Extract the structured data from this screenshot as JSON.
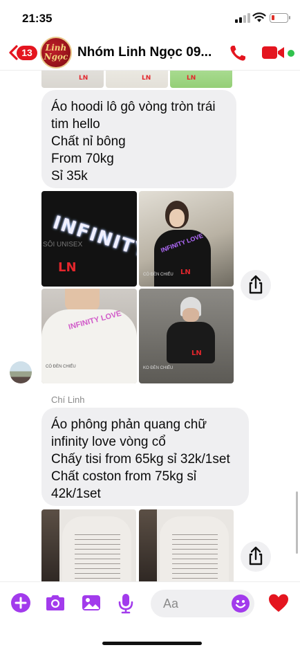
{
  "status": {
    "time": "21:35"
  },
  "header": {
    "back_badge": "13",
    "group_logo_line1": "Linh",
    "group_logo_line2": "Ngọc",
    "title": "Nhóm Linh Ngọc 09..."
  },
  "messages": {
    "msg1": [
      "Áo hoodi lô gô vòng tròn trái",
      "tim hello",
      "Chất nỉ bông",
      "From 70kg",
      "Sỉ 35k"
    ],
    "sender_name": "Chí Linh",
    "msg2": [
      "Áo phông phản quang chữ",
      "infinity love vòng cổ",
      "Chấy tisi from 65kg sỉ 32k/1set",
      "Chất coston from 75kg sỉ",
      "42k/1set"
    ]
  },
  "photos": {
    "p1_text": "INFINITY",
    "p1_tag": "SÔI UNISEX",
    "p1_brand": "LN",
    "p2_text": "INFINITY LOVE",
    "p2_brand": "LN",
    "p2_caption": "CÓ ĐÈN CHIẾU",
    "p3_text": "INFINITY LOVE",
    "p3_caption": "CÓ ĐÈN CHIẾU",
    "p4_brand": "LN",
    "p4_caption": "KO ĐÈN CHIẾU",
    "strip_brand": "LN"
  },
  "composer": {
    "placeholder": "Aa"
  },
  "colors": {
    "accent": "#a23bec",
    "badge": "#e4151f",
    "call": "#e4151f",
    "online": "#31c24d",
    "bubble": "#efeff1"
  },
  "icons": {
    "back": "chevron-left-icon",
    "call": "phone-icon",
    "video": "video-camera-icon",
    "share": "share-icon",
    "plus": "plus-circle-icon",
    "camera": "camera-icon",
    "gallery": "photo-icon",
    "mic": "microphone-icon",
    "emoji": "smiley-icon",
    "like": "heart-icon"
  }
}
